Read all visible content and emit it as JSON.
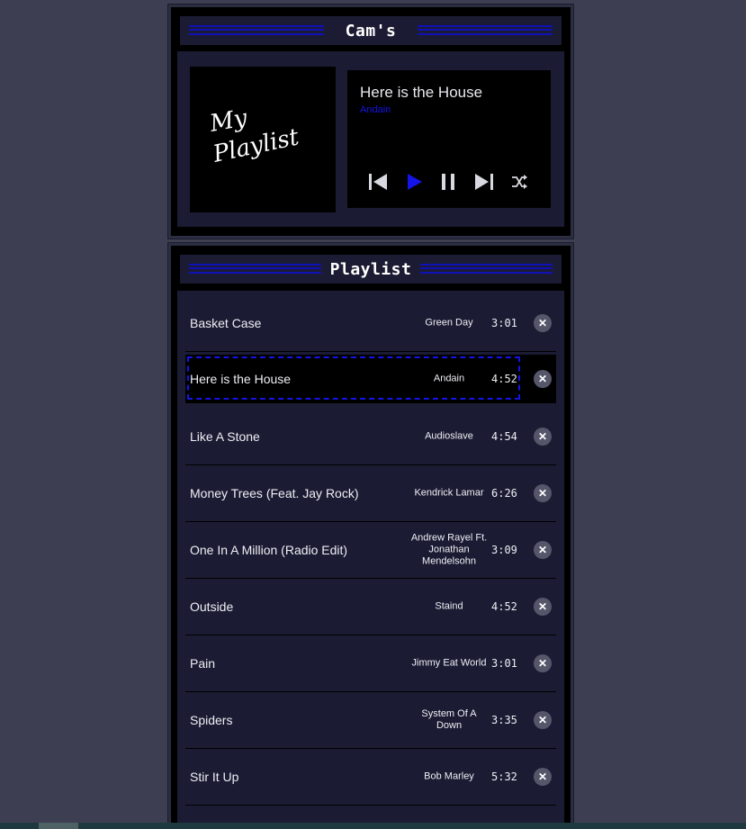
{
  "player": {
    "title": "Cam's",
    "cover_text_line1": "My",
    "cover_text_line2": "Playlist",
    "now_playing": {
      "title": "Here is the House",
      "artist": "Andain"
    },
    "controls": {
      "prev_icon": "skip-previous-icon",
      "play_icon": "play-icon",
      "pause_icon": "pause-icon",
      "next_icon": "skip-next-icon",
      "shuffle_icon": "shuffle-icon"
    },
    "colors": {
      "accent": "#1414e6",
      "panel": "#1b1c33",
      "background": "#3d3e52"
    }
  },
  "playlist": {
    "title": "Playlist",
    "active_index": 1,
    "tracks": [
      {
        "name": "Basket Case",
        "artist": "Green Day",
        "time": "3:01"
      },
      {
        "name": "Here is the House",
        "artist": "Andain",
        "time": "4:52"
      },
      {
        "name": "Like A Stone",
        "artist": "Audioslave",
        "time": "4:54"
      },
      {
        "name": "Money Trees (Feat. Jay Rock)",
        "artist": "Kendrick Lamar",
        "time": "6:26"
      },
      {
        "name": "One In A Million (Radio Edit)",
        "artist": "Andrew Rayel Ft. Jonathan Mendelsohn",
        "time": "3:09"
      },
      {
        "name": "Outside",
        "artist": "Staind",
        "time": "4:52"
      },
      {
        "name": "Pain",
        "artist": "Jimmy Eat World",
        "time": "3:01"
      },
      {
        "name": "Spiders",
        "artist": "System Of A Down",
        "time": "3:35"
      },
      {
        "name": "Stir It Up",
        "artist": "Bob Marley",
        "time": "5:32"
      }
    ],
    "remove_icon": "close-circle-icon"
  }
}
